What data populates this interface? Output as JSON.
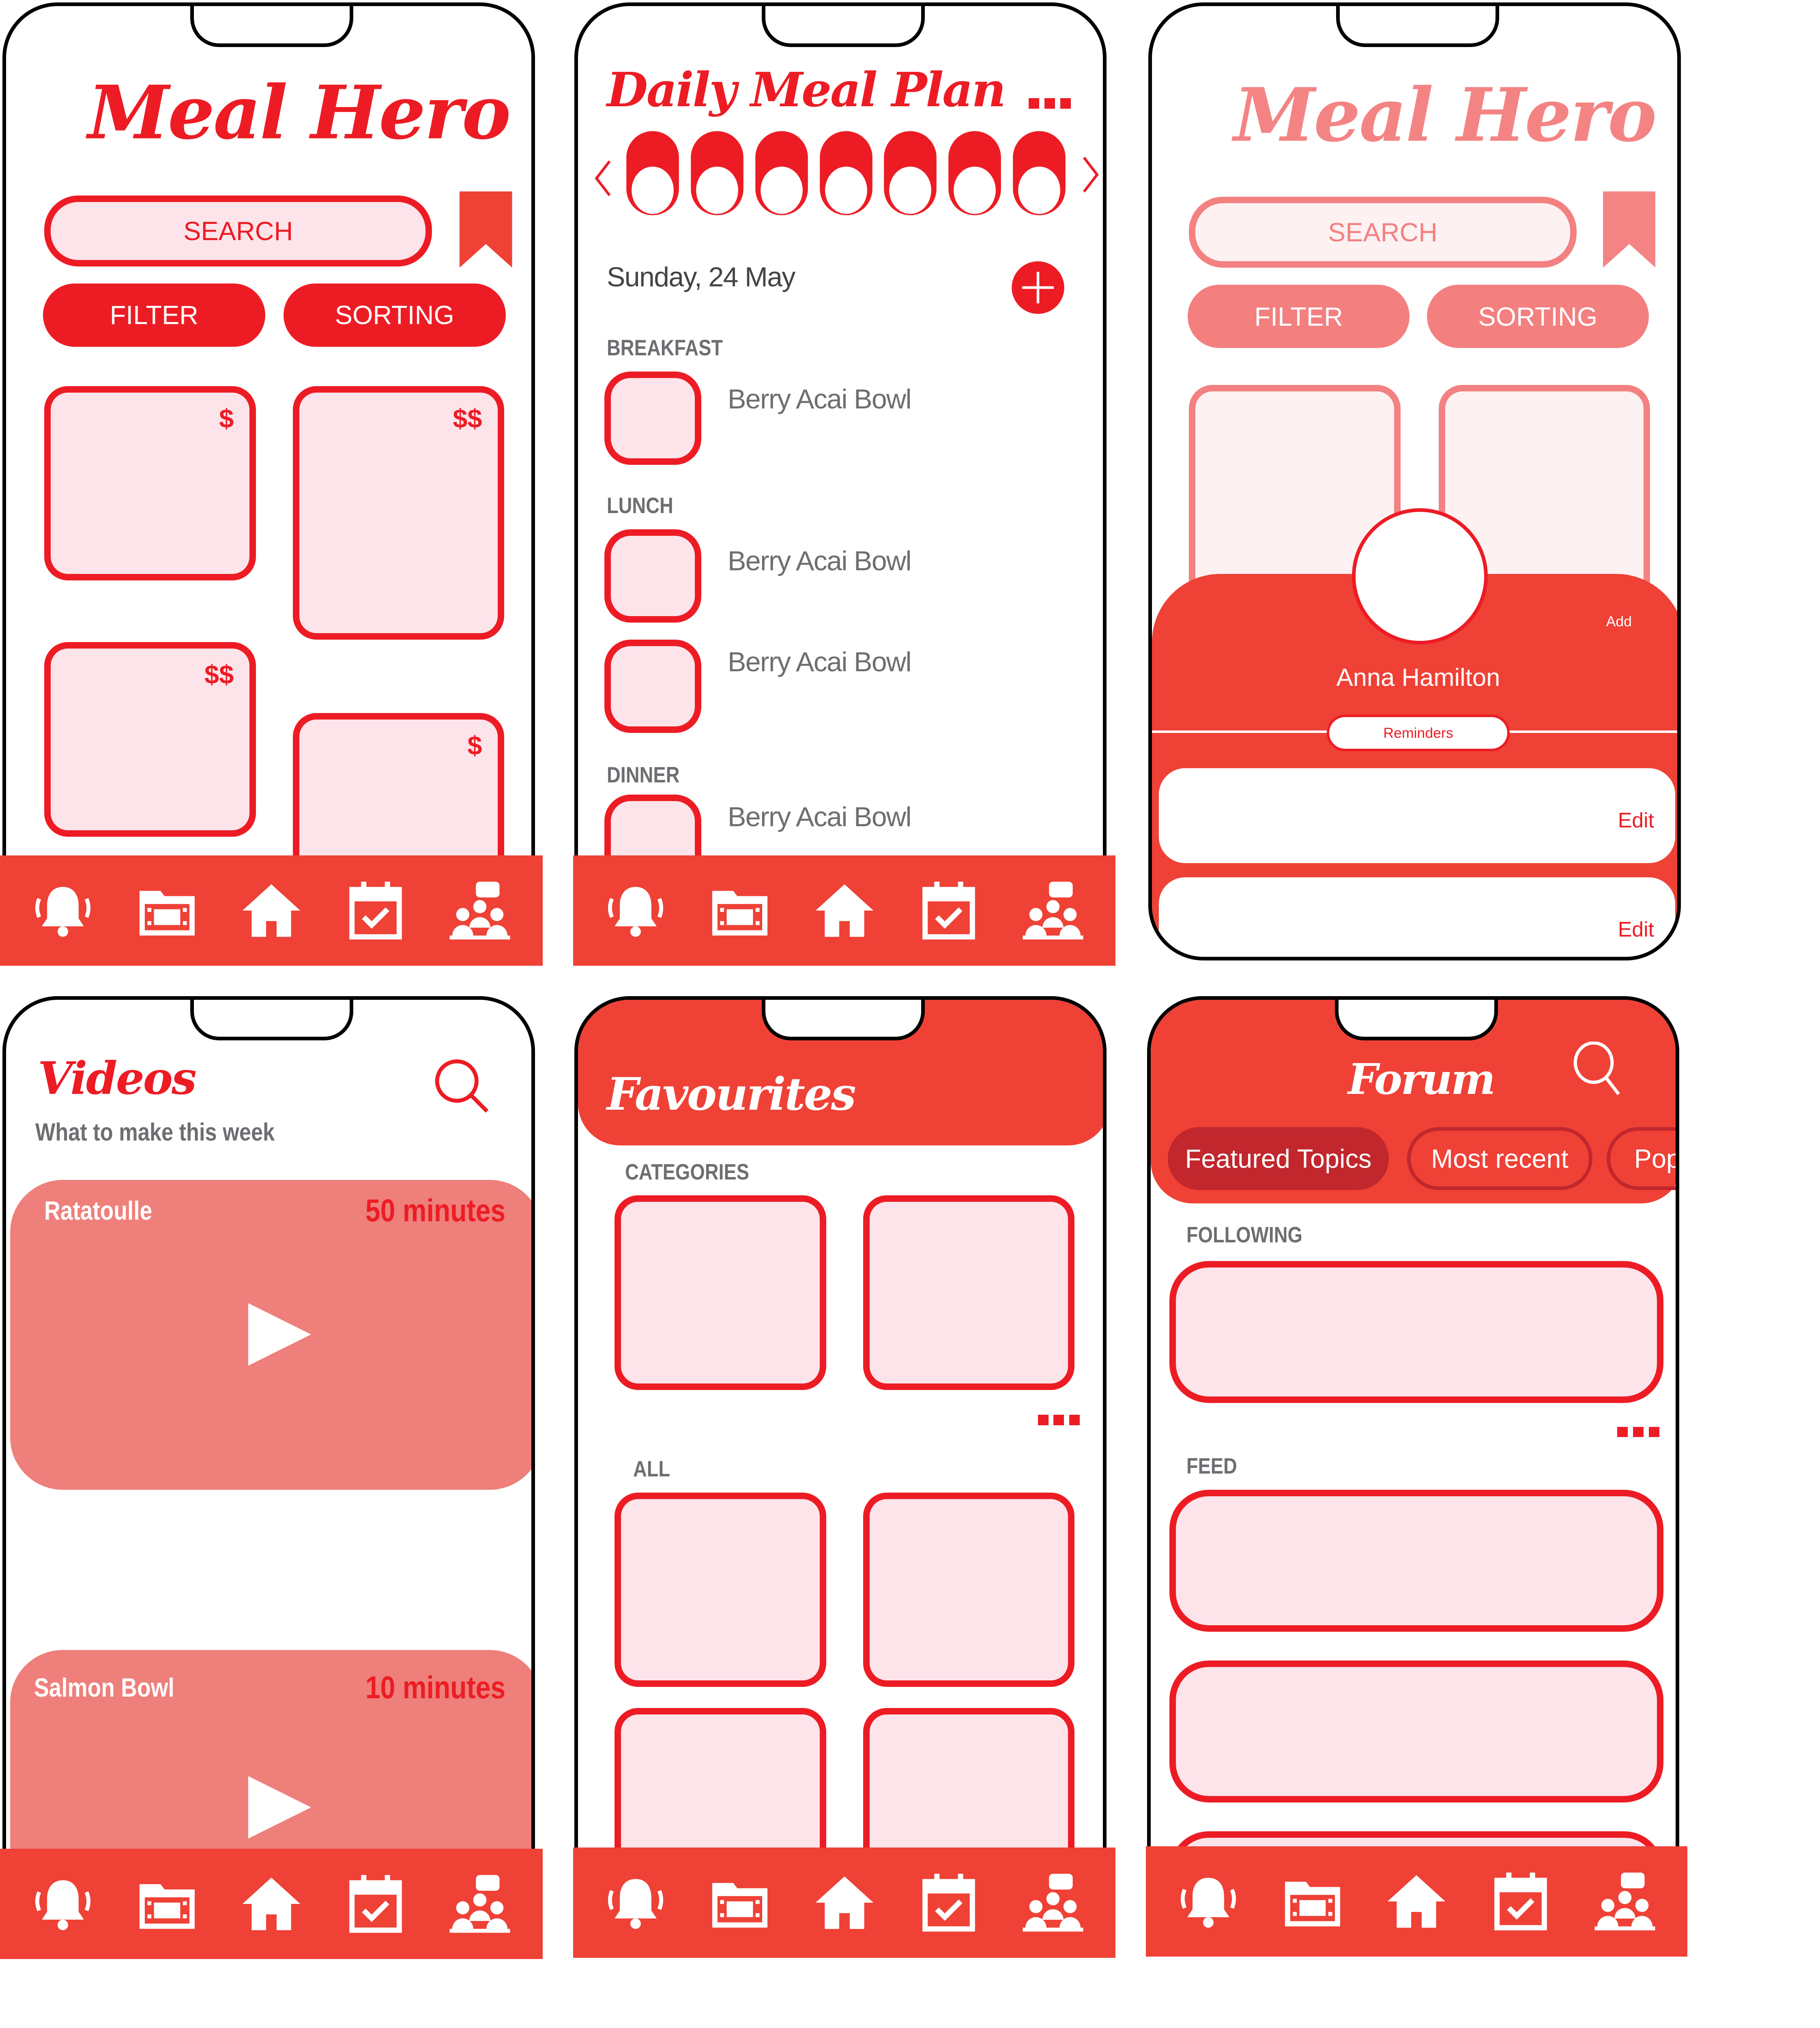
{
  "colors": {
    "primary": "#ED1C24",
    "header": "#EF4136",
    "card_fill": "#FCE4EA",
    "faded": "#F38181",
    "video_card": "#EE7F7A",
    "dark_red": "#C1272D",
    "label_gray": "#6D6E71"
  },
  "nav": [
    {
      "icon": "bell-icon",
      "label": "notifications"
    },
    {
      "icon": "film-icon",
      "label": "videos"
    },
    {
      "icon": "home-icon",
      "label": "home"
    },
    {
      "icon": "calendar-check-icon",
      "label": "meal plan"
    },
    {
      "icon": "community-icon",
      "label": "forum"
    }
  ],
  "home": {
    "title": "Meal Hero",
    "search_placeholder": "SEARCH",
    "filter": "FILTER",
    "sorting": "SORTING",
    "prices": [
      "$",
      "$$",
      "$$",
      "$"
    ]
  },
  "meal_plan": {
    "title": "Daily Meal Plan",
    "date": "Sunday, 24 May",
    "breakfast_label": "BREAKFAST",
    "lunch_label": "LUNCH",
    "dinner_label": "DINNER",
    "breakfast": [
      "Berry Acai Bowl"
    ],
    "lunch": [
      "Berry Acai Bowl",
      "Berry Acai Bowl"
    ],
    "dinner": [
      "Berry Acai Bowl"
    ]
  },
  "profile": {
    "title": "Meal Hero",
    "search_placeholder": "SEARCH",
    "filter": "FILTER",
    "sorting": "SORTING",
    "add_label": "Add",
    "name": "Anna Hamilton",
    "tab": "Reminders",
    "edit_labels": [
      "Edit",
      "Edit"
    ]
  },
  "videos": {
    "title": "Videos",
    "subtitle": "What to make this week",
    "items": [
      {
        "name": "Ratatoulle",
        "duration": "50 minutes"
      },
      {
        "name": "Salmon Bowl",
        "duration": "10 minutes"
      }
    ]
  },
  "favourites": {
    "title": "Favourites",
    "categories_label": "CATEGORIES",
    "all_label": "ALL"
  },
  "forum": {
    "title": "Forum",
    "tabs": [
      "Featured Topics",
      "Most recent",
      "Pop"
    ],
    "following_label": "FOLLOWING",
    "feed_label": "FEED"
  }
}
